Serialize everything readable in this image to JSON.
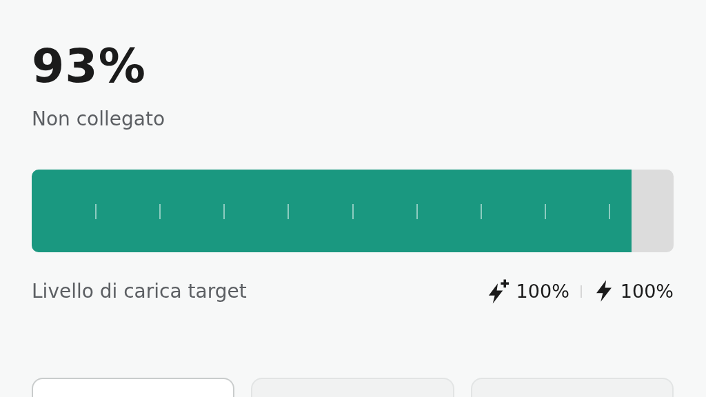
{
  "battery": {
    "percent": "93%",
    "status": "Non collegato"
  },
  "charge_bar": {
    "level": 0.935
  },
  "target": {
    "label": "Livello di carica target",
    "limits": [
      {
        "kind": "boost",
        "value": "100%"
      },
      {
        "kind": "normal",
        "value": "100%"
      }
    ]
  },
  "cards": [
    {
      "selected": true
    },
    {
      "selected": false
    },
    {
      "selected": false
    }
  ]
}
